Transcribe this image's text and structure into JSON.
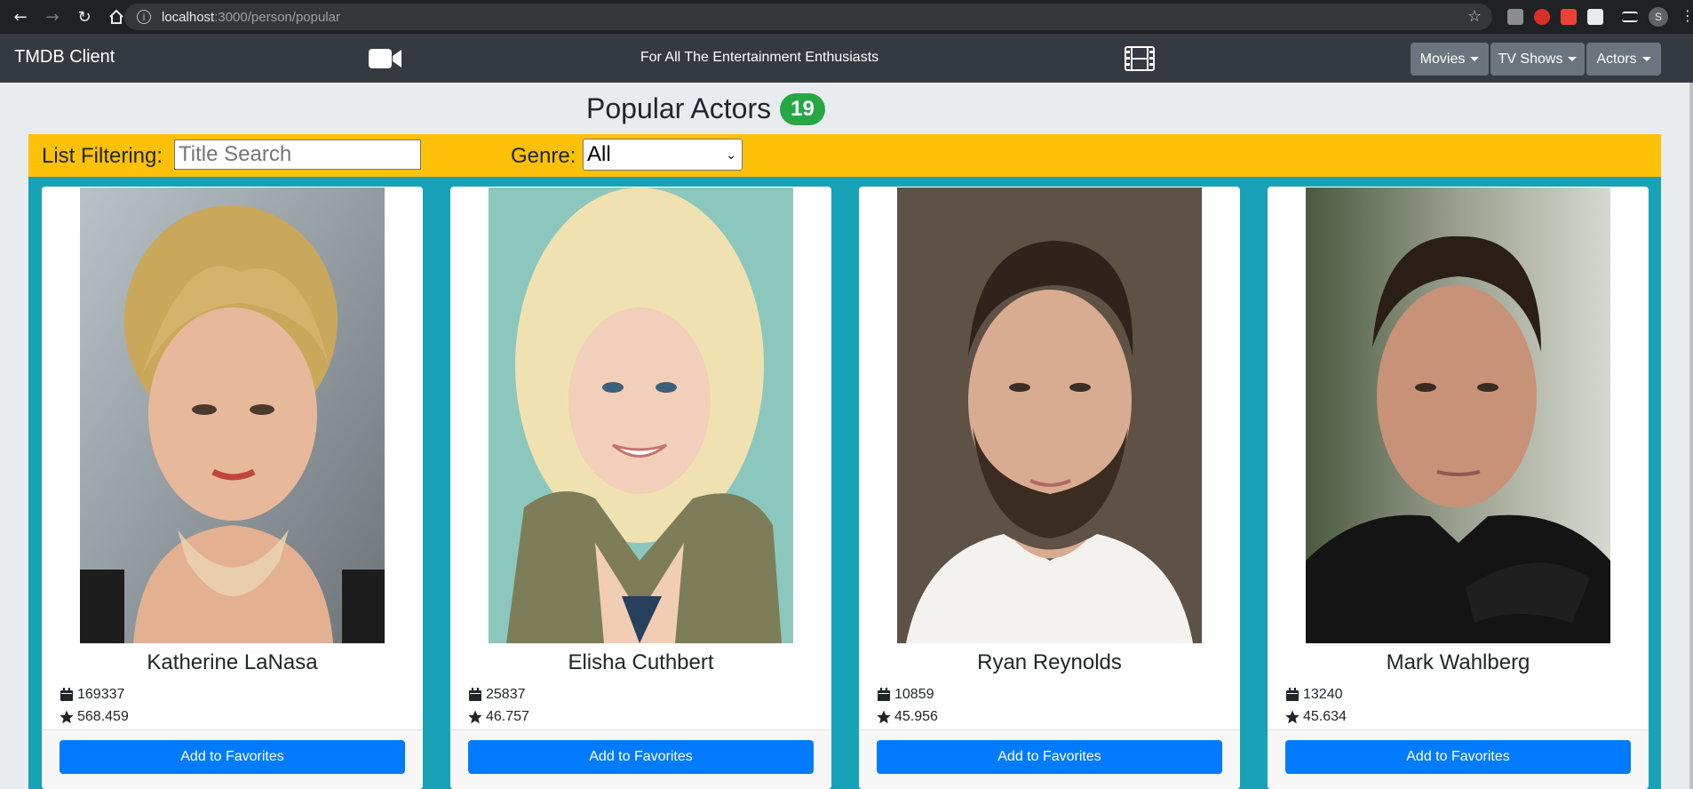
{
  "browser": {
    "url_host": "localhost",
    "url_rest": ":3000/person/popular",
    "profile_initial": "S"
  },
  "navbar": {
    "brand": "TMDB Client",
    "tagline": "For All The Entertainment Enthusiasts",
    "menus": [
      "Movies",
      "TV Shows",
      "Actors"
    ]
  },
  "page": {
    "title": "Popular Actors",
    "count": "19"
  },
  "filter": {
    "label": "List Filtering:",
    "search_placeholder": "Title Search",
    "genre_label": "Genre:",
    "genre_value": "All"
  },
  "actors": [
    {
      "name": "Katherine LaNasa",
      "id": "169337",
      "popularity": "568.459",
      "button": "Add to Favorites"
    },
    {
      "name": "Elisha Cuthbert",
      "id": "25837",
      "popularity": "46.757",
      "button": "Add to Favorites"
    },
    {
      "name": "Ryan Reynolds",
      "id": "10859",
      "popularity": "45.956",
      "button": "Add to Favorites"
    },
    {
      "name": "Mark Wahlberg",
      "id": "13240",
      "popularity": "45.634",
      "button": "Add to Favorites"
    }
  ],
  "colors": {
    "navbar": "#343a40",
    "badge": "#28a745",
    "filterbar": "#ffc107",
    "cards_bg": "#17a2b8",
    "button": "#007bff"
  }
}
